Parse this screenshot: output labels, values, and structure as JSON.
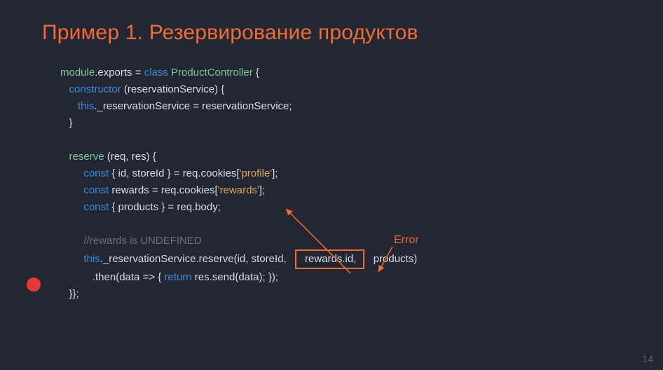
{
  "slide": {
    "title": "Пример 1. Резервирование продуктов",
    "error_label": "Error",
    "page_number": "14"
  },
  "code": {
    "l1_a": "module",
    "l1_b": ".exports = ",
    "l1_c": "class ",
    "l1_d": "ProductController",
    "l1_e": " {",
    "l2_a": "constructor ",
    "l2_b": "(reservationService) {",
    "l3_a": "this",
    "l3_b": "._reservationService = reservationService;",
    "l4": "}",
    "l6_a": "reserve ",
    "l6_b": "(req, res) {",
    "l7_a": "const ",
    "l7_b": "{ id, storeId } = req.cookies[",
    "l7_c": "'profile'",
    "l7_d": "];",
    "l8_a": "const ",
    "l8_b": "rewards = req.cookies[",
    "l8_c": "'rewards'",
    "l8_d": "];",
    "l9_a": "const ",
    "l9_b": "{ products } = req.body;",
    "l11": "//rewards is UNDEFINED",
    "l12_a": "this",
    "l12_b": "._reservationService.reserve(id, storeId,",
    "l12_box": "rewards.id,",
    "l12_c": "products)",
    "l13_a": ".then(data => { ",
    "l13_b": "return ",
    "l13_c": "res.send(data); });",
    "l14": "}};"
  }
}
